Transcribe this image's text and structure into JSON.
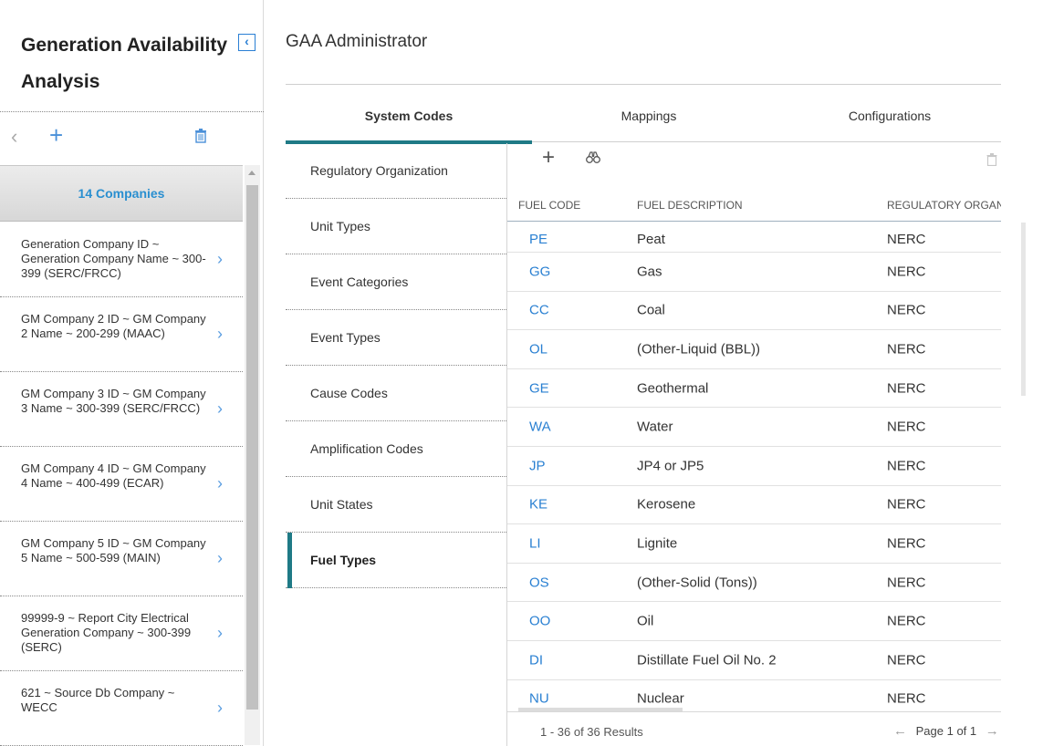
{
  "sidebar": {
    "title": "Generation Availability Analysis",
    "header": "14 Companies",
    "companies": [
      "Generation Company ID ~ Generation Company Name ~ 300-399 (SERC/FRCC)",
      "GM Company 2 ID ~ GM Company 2 Name ~ 200-299 (MAAC)",
      "GM Company 3 ID ~ GM Company 3 Name ~ 300-399 (SERC/FRCC)",
      "GM Company 4 ID ~ GM Company 4 Name ~ 400-499 (ECAR)",
      "GM Company 5 ID ~ GM Company 5 Name ~ 500-599 (MAIN)",
      "99999-9 ~ Report City Electrical Generation Company ~ 300-399 (SERC)",
      "621 ~ Source Db Company ~ WECC"
    ]
  },
  "main": {
    "title": "GAA Administrator",
    "tabs": [
      "System Codes",
      "Mappings",
      "Configurations"
    ],
    "active_tab": "System Codes",
    "nav": [
      "Regulatory Organization",
      "Unit Types",
      "Event Categories",
      "Event Types",
      "Cause Codes",
      "Amplification Codes",
      "Unit States",
      "Fuel Types"
    ],
    "active_nav": "Fuel Types"
  },
  "grid": {
    "columns": [
      "FUEL CODE",
      "FUEL DESCRIPTION",
      "REGULATORY ORGANIZATION"
    ],
    "rows": [
      [
        "PE",
        "Peat",
        "NERC"
      ],
      [
        "GG",
        "Gas",
        "NERC"
      ],
      [
        "CC",
        "Coal",
        "NERC"
      ],
      [
        "OL",
        "(Other-Liquid (BBL))",
        "NERC"
      ],
      [
        "GE",
        "Geothermal",
        "NERC"
      ],
      [
        "WA",
        "Water",
        "NERC"
      ],
      [
        "JP",
        "JP4 or JP5",
        "NERC"
      ],
      [
        "KE",
        "Kerosene",
        "NERC"
      ],
      [
        "LI",
        "Lignite",
        "NERC"
      ],
      [
        "OS",
        "(Other-Solid (Tons))",
        "NERC"
      ],
      [
        "OO",
        "Oil",
        "NERC"
      ],
      [
        "DI",
        "Distillate Fuel Oil No. 2",
        "NERC"
      ],
      [
        "NU",
        "Nuclear",
        "NERC"
      ]
    ],
    "results": "1 - 36 of 36 Results",
    "page_label": "Page 1 of 1"
  },
  "icons": {
    "back": "‹",
    "add": "+",
    "chevron": "›",
    "collapse": "‹",
    "prev": "←",
    "next": "→"
  },
  "colors": {
    "accent": "#1f7a86",
    "link": "#2a80d2"
  }
}
